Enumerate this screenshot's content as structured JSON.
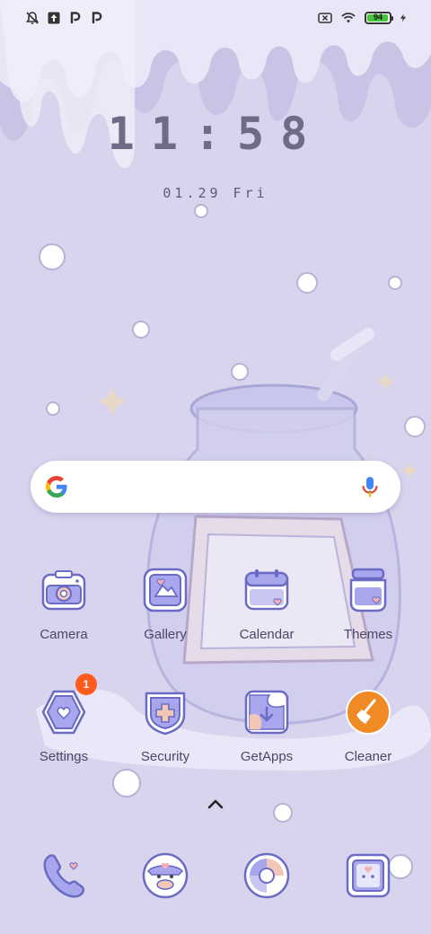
{
  "status_bar": {
    "left_icons": [
      "notifications-muted-icon",
      "upload-icon",
      "parking-icon",
      "parking-icon"
    ],
    "right_icons": [
      "sim-off-icon",
      "wifi-icon"
    ],
    "battery_level": "94",
    "charging_icon": "lightning-icon"
  },
  "lock": {
    "time": "11:58",
    "date": "01.29 Fri"
  },
  "search": {
    "google_icon": "google-g-icon",
    "mic_icon": "microphone-icon"
  },
  "apps": [
    {
      "label": "Camera",
      "icon": "camera-icon"
    },
    {
      "label": "Gallery",
      "icon": "gallery-icon"
    },
    {
      "label": "Calendar",
      "icon": "calendar-icon"
    },
    {
      "label": "Themes",
      "icon": "themes-jar-icon"
    },
    {
      "label": "Settings",
      "icon": "settings-hexagon-icon",
      "badge": "1"
    },
    {
      "label": "Security",
      "icon": "security-shield-icon"
    },
    {
      "label": "GetApps",
      "icon": "getapps-icon"
    },
    {
      "label": "Cleaner",
      "icon": "cleaner-broom-icon"
    }
  ],
  "dock": [
    "phone-icon",
    "messages-cow-icon",
    "browser-icon",
    "notes-icon"
  ],
  "colors": {
    "wallpaper": "#d8d4ee",
    "icon_outline": "#6a6bc4",
    "icon_fill": "#a8a6ec",
    "badge": "#ff5b1f",
    "cleaner_orange": "#f08a24"
  }
}
